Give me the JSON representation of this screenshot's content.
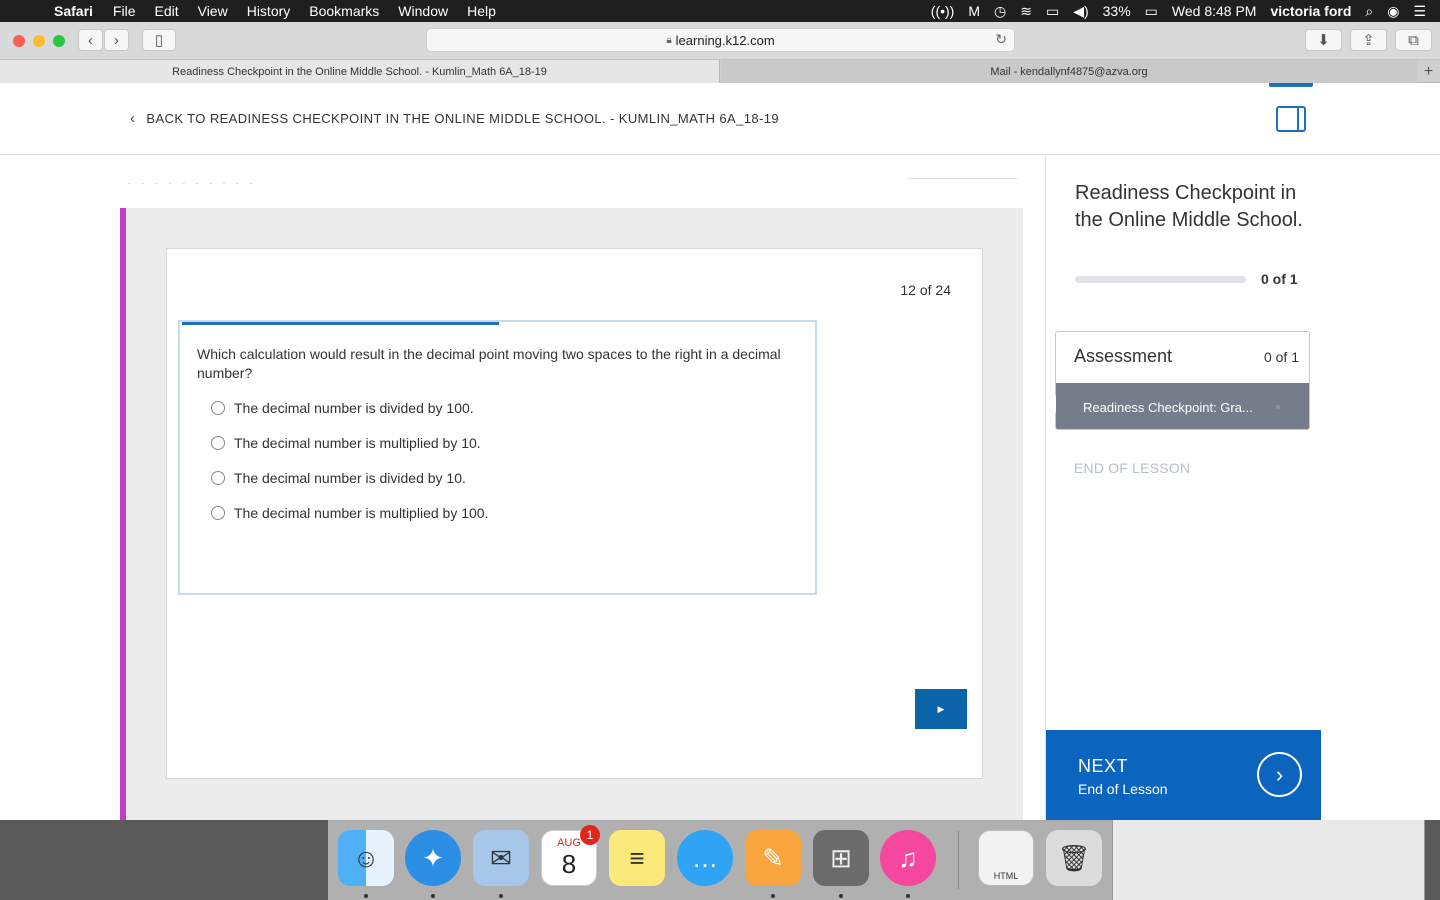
{
  "menubar": {
    "apple_icon": "",
    "app_name": "Safari",
    "items": [
      "File",
      "Edit",
      "View",
      "History",
      "Bookmarks",
      "Window",
      "Help"
    ],
    "status_icons": [
      "airdrop-icon",
      "malwarebytes-icon",
      "time-machine-icon",
      "wifi-icon",
      "airplay-icon",
      "volume-icon"
    ],
    "battery": "33%",
    "clock": "Wed 8:48 PM",
    "user": "victoria ford"
  },
  "browser": {
    "url": "learning.k12.com",
    "tabs": [
      {
        "label": "Readiness Checkpoint in the Online Middle School. - Kumlin_Math 6A_18-19"
      },
      {
        "label": "Mail - kendallynf4875@azva.org"
      }
    ],
    "new_tab_glyph": "+"
  },
  "header": {
    "back_label": "BACK TO READINESS CHECKPOINT IN THE ONLINE MIDDLE SCHOOL. - KUMLIN_MATH 6A_18-19",
    "back_glyph": "‹"
  },
  "question": {
    "counter": "12 of 24",
    "progress": 0.5,
    "text": "Which calculation would result in the decimal point moving two spaces to the right in a decimal number?",
    "options": [
      "The decimal number is divided by 100.",
      "The decimal number is multiplied by 10.",
      "The decimal number is divided by 10.",
      "The decimal number is multiplied by 100."
    ],
    "next_glyph": "▶"
  },
  "sidebar": {
    "lesson_title": "Readiness Checkpoint in the Online Middle School.",
    "lesson_progress": 0,
    "lesson_count": "0 of 1",
    "assessment_label": "Assessment",
    "assessment_count": "0 of 1",
    "assessment_item": "Readiness Checkpoint: Gra...",
    "end_label": "END OF LESSON",
    "next_label": "NEXT",
    "next_sub": "End of Lesson",
    "next_glyph": "›"
  },
  "dock": {
    "calendar_month": "AUG",
    "calendar_day": "8",
    "calendar_badge": "1",
    "html_label": "HTML"
  },
  "colors": {
    "accent_magenta": "#c23bc4",
    "brand_blue": "#0b64be",
    "progress_blue": "#1f6fbe"
  }
}
